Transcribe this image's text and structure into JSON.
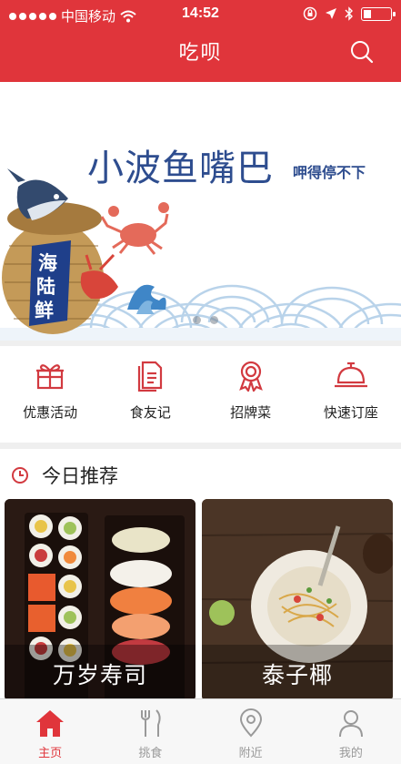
{
  "status_bar": {
    "carrier": "中国移动",
    "time": "14:52"
  },
  "header": {
    "title": "吃呗"
  },
  "banner": {
    "title": "小波鱼嘴巴",
    "subtitle": "呷得停不下",
    "badge_lines": [
      "海",
      "陆",
      "鲜"
    ],
    "dot_count": 2
  },
  "categories": [
    {
      "label": "优惠活动",
      "icon": "gift-icon"
    },
    {
      "label": "食友记",
      "icon": "note-icon"
    },
    {
      "label": "招牌菜",
      "icon": "ribbon-icon"
    },
    {
      "label": "快速订座",
      "icon": "service-bell-icon"
    }
  ],
  "recommend": {
    "title": "今日推荐",
    "cards": [
      {
        "name": "万岁寿司"
      },
      {
        "name": "泰子椰"
      }
    ]
  },
  "tabbar": [
    {
      "label": "主页",
      "icon": "home-icon",
      "active": true
    },
    {
      "label": "挑食",
      "icon": "fork-knife-icon",
      "active": false
    },
    {
      "label": "附近",
      "icon": "location-pin-icon",
      "active": false
    },
    {
      "label": "我的",
      "icon": "person-icon",
      "active": false
    }
  ],
  "colors": {
    "accent": "#e0353b",
    "banner_text": "#2e4d8f"
  }
}
